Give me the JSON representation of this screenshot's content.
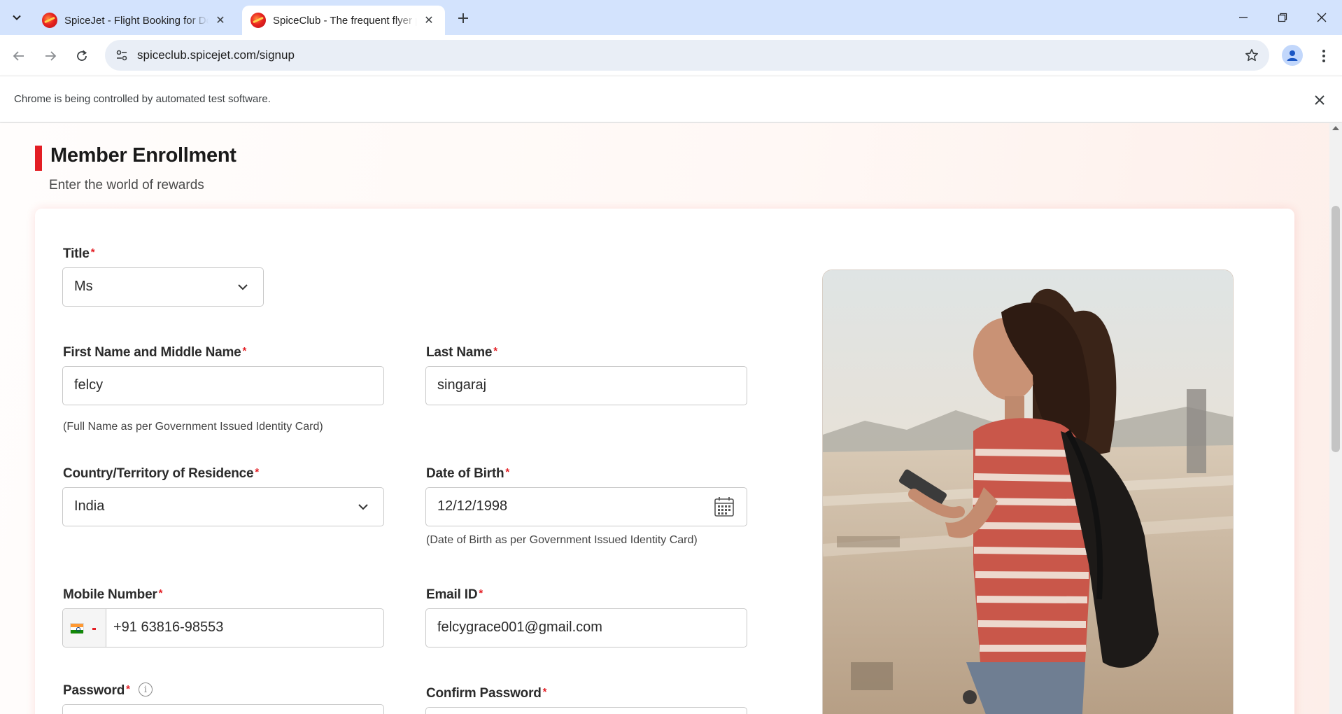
{
  "browser": {
    "tabs": [
      {
        "title": "SpiceJet - Flight Booking for Domestic and International",
        "active": false
      },
      {
        "title": "SpiceClub - The frequent flyer program",
        "active": true
      }
    ],
    "url": "spiceclub.spicejet.com/signup",
    "infobar_text": "Chrome is being controlled by automated test software."
  },
  "page": {
    "title": "Member Enrollment",
    "subtitle": "Enter the world of rewards",
    "accent_color": "#e31e24"
  },
  "form": {
    "title_field": {
      "label": "Title",
      "required_mark": "*",
      "value": "Ms"
    },
    "first_name": {
      "label": "First Name and Middle Name",
      "required_mark": "*",
      "value": "felcy",
      "helper": "(Full Name as per Government Issued Identity Card)"
    },
    "last_name": {
      "label": "Last Name",
      "required_mark": "*",
      "value": "singaraj"
    },
    "country": {
      "label": "Country/Territory of Residence",
      "required_mark": "*",
      "value": "India"
    },
    "dob": {
      "label": "Date of Birth",
      "required_mark": "*",
      "value": "12/12/1998",
      "helper": "(Date of Birth as per Government Issued Identity Card)"
    },
    "mobile": {
      "label": "Mobile Number",
      "required_mark": "*",
      "value": "+91 63816-98553",
      "country_flag": "india-flag-icon"
    },
    "email": {
      "label": "Email ID",
      "required_mark": "*",
      "value": "felcygrace001@gmail.com"
    },
    "password": {
      "label": "Password",
      "required_mark": "*",
      "info_icon": "info-icon"
    },
    "confirm_password": {
      "label": "Confirm Password",
      "required_mark": "*"
    }
  },
  "icons": {
    "tab_search": "chevron-down-icon",
    "new_tab": "plus-icon",
    "back": "arrow-left-icon",
    "forward": "arrow-right-icon",
    "reload": "reload-icon",
    "site_info": "tune-icon",
    "bookmark": "star-icon",
    "profile": "person-icon",
    "menu": "kebab-menu-icon",
    "calendar": "calendar-icon",
    "dropdown": "chevron-down-icon"
  }
}
